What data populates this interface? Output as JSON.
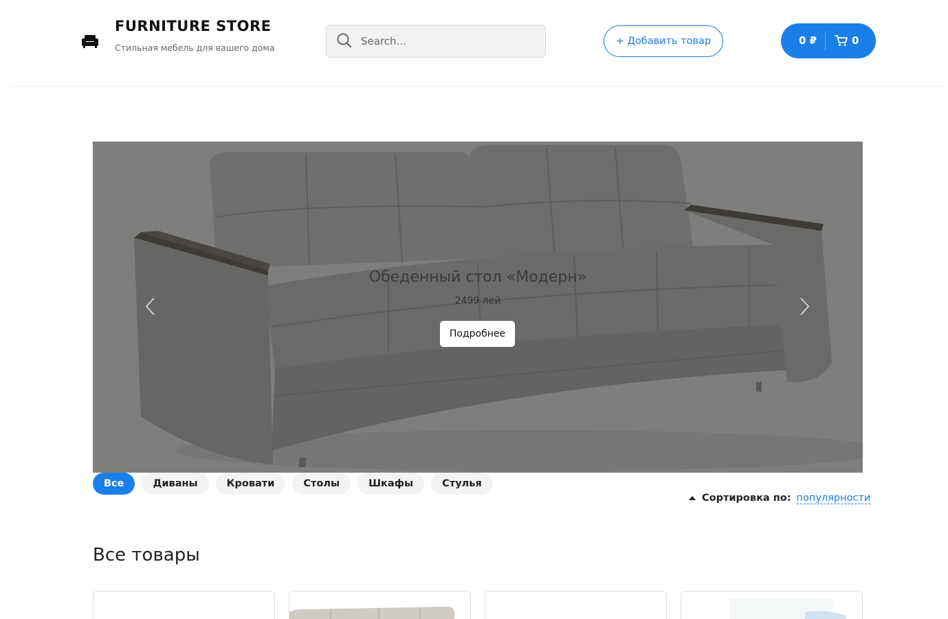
{
  "header": {
    "brand_title": "FURNITURE STORE",
    "brand_subtitle": "Стильная мебель для вашего дома",
    "logo_icon": "armchair-icon",
    "search": {
      "placeholder": "Search...",
      "value": "",
      "icon": "search-icon"
    },
    "add_product_label": "+ Добавить товар",
    "cart": {
      "total": "0 ₽",
      "count": "0",
      "icon": "cart-icon"
    }
  },
  "hero": {
    "title": "Обеденный стол «Модерн»",
    "price": "2499 лей",
    "button_label": "Подробнее",
    "prev_icon": "chevron-left-icon",
    "next_icon": "chevron-right-icon"
  },
  "categories": [
    {
      "label": "Все",
      "active": true
    },
    {
      "label": "Диваны",
      "active": false
    },
    {
      "label": "Кровати",
      "active": false
    },
    {
      "label": "Столы",
      "active": false
    },
    {
      "label": "Шкафы",
      "active": false
    },
    {
      "label": "Стулья",
      "active": false
    }
  ],
  "sort": {
    "label": "Сортировка по:",
    "value": "популярности"
  },
  "products_section": {
    "title": "Все товары"
  },
  "colors": {
    "accent": "#1a7fe8",
    "hero_overlay": "#7e7e7d"
  }
}
